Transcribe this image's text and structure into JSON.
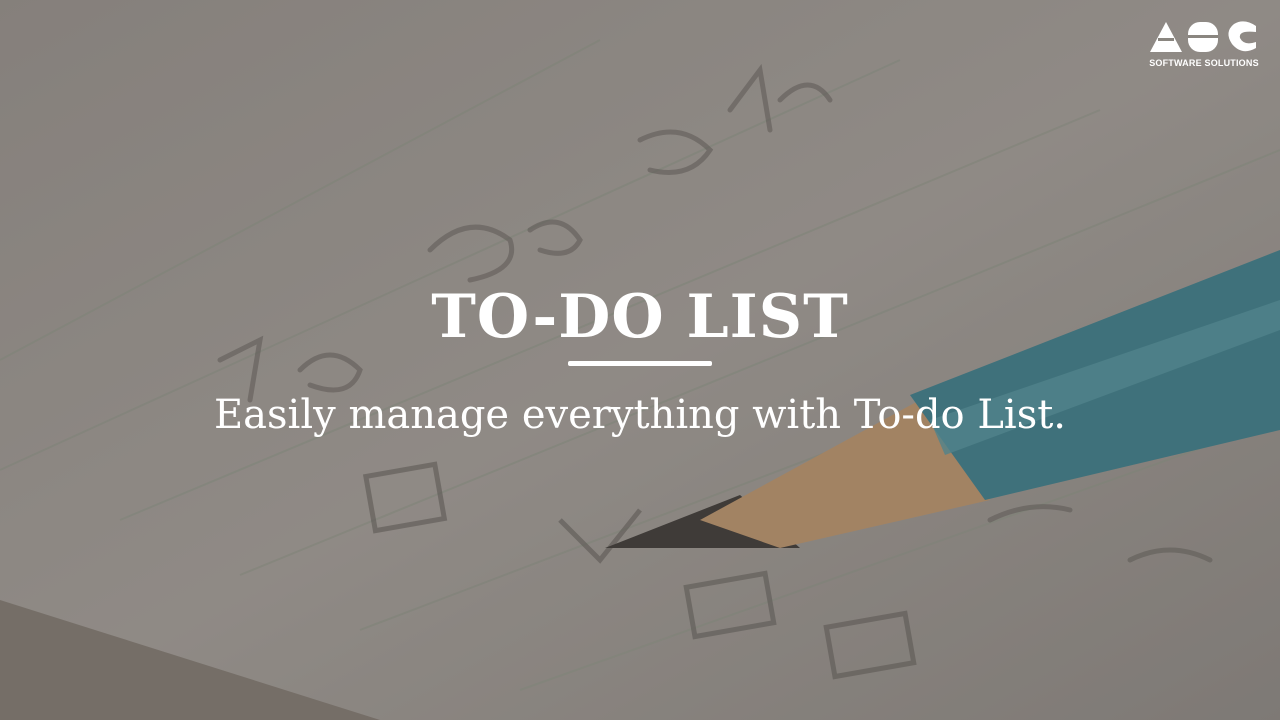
{
  "slide": {
    "title": "TO-DO LIST",
    "subtitle": "Easily manage everything with To-do List."
  },
  "logo": {
    "mark": "ABC",
    "tagline": "SOFTWARE SOLUTIONS"
  },
  "background": {
    "description_icon": "notebook-pencil-photo",
    "overlay_color": "#6e6a66",
    "pencil_color": "#2f7f8f",
    "wood_color": "#c79a6a"
  }
}
